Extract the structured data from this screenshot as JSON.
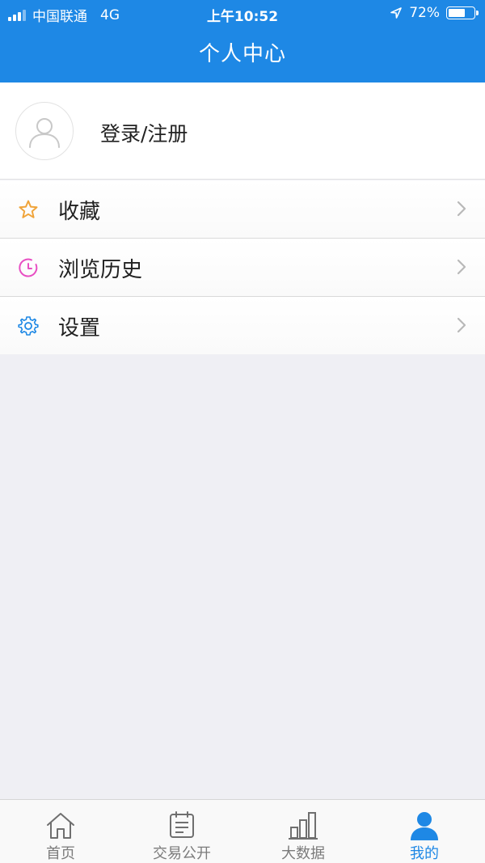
{
  "status_bar": {
    "carrier": "中国联通",
    "network": "4G",
    "time": "上午10:52",
    "battery_percent": "72%",
    "battery_level": 0.72
  },
  "header": {
    "title": "个人中心"
  },
  "profile": {
    "login_label": "登录/注册",
    "avatar_icon": "user-placeholder-icon"
  },
  "menu": [
    {
      "label": "收藏",
      "icon": "star-icon",
      "icon_color": "#f0a43a"
    },
    {
      "label": "浏览历史",
      "icon": "clock-icon",
      "icon_color": "#e84fc3"
    },
    {
      "label": "设置",
      "icon": "gear-icon",
      "icon_color": "#1e88e5"
    }
  ],
  "tabbar": {
    "tabs": [
      {
        "label": "首页",
        "icon": "home-icon",
        "active": false
      },
      {
        "label": "交易公开",
        "icon": "notepad-icon",
        "active": false
      },
      {
        "label": "大数据",
        "icon": "bar-chart-icon",
        "active": false
      },
      {
        "label": "我的",
        "icon": "user-icon",
        "active": true
      }
    ],
    "active_color": "#1e88e5",
    "inactive_color": "#7b7b7b"
  },
  "colors": {
    "header_bg": "#1e88e5",
    "page_bg": "#efeff4"
  }
}
